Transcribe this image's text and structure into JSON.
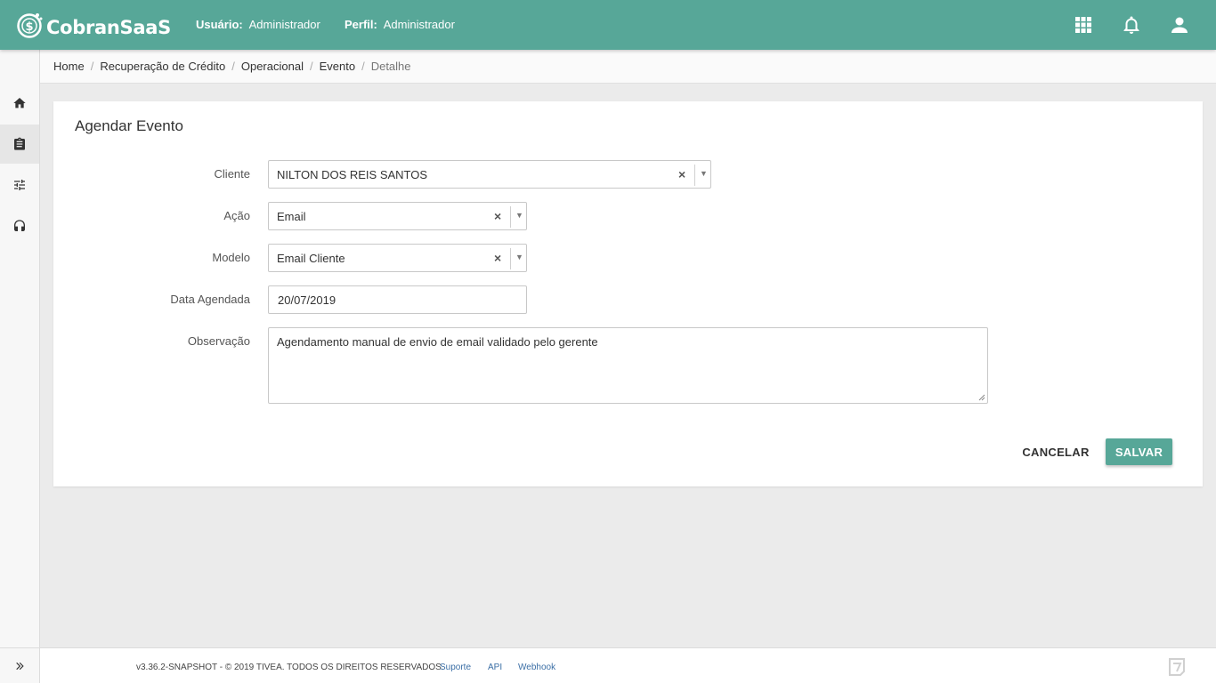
{
  "app": {
    "name": "CobranSaaS",
    "accent_color": "#57a798"
  },
  "header": {
    "user_label": "Usuário:",
    "user_value": "Administrador",
    "profile_label": "Perfil:",
    "profile_value": "Administrador",
    "icons": [
      "apps-grid-icon",
      "bell-icon",
      "user-icon"
    ]
  },
  "sidebar": {
    "items": [
      {
        "icon": "home-icon"
      },
      {
        "icon": "clipboard-icon",
        "active": true
      },
      {
        "icon": "sliders-icon"
      },
      {
        "icon": "headset-icon"
      }
    ],
    "expand_icon": "double-chevron-right-icon"
  },
  "breadcrumb": [
    "Home",
    "Recuperação de Crédito",
    "Operacional",
    "Evento",
    "Detalhe"
  ],
  "form": {
    "title": "Agendar Evento",
    "cliente": {
      "label": "Cliente",
      "value": "NILTON DOS REIS SANTOS"
    },
    "acao": {
      "label": "Ação",
      "value": "Email"
    },
    "modelo": {
      "label": "Modelo",
      "value": "Email Cliente"
    },
    "data": {
      "label": "Data Agendada",
      "value": "20/07/2019"
    },
    "observacao": {
      "label": "Observação",
      "value": "Agendamento manual de envio de email validado pelo gerente"
    },
    "cancel_label": "CANCELAR",
    "save_label": "SALVAR"
  },
  "footer": {
    "copyright": "v3.36.2-SNAPSHOT - © 2019 TIVEA. TODOS OS DIREITOS RESERVADOS.",
    "links": [
      "Suporte",
      "API",
      "Webhook"
    ]
  }
}
